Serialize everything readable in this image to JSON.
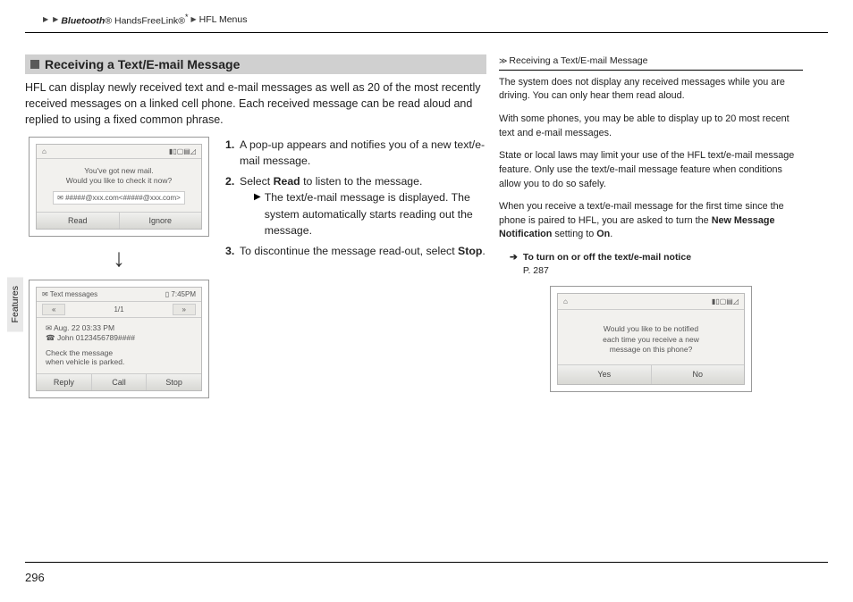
{
  "breadcrumb": {
    "b1": "Bluetooth",
    "reg": "®",
    "b2": " HandsFreeLink",
    "star": "*",
    "b3": "HFL Menus"
  },
  "section_title": "Receiving a Text/E-mail Message",
  "intro": "HFL can display newly received text and e-mail messages as well as 20 of the most recently received messages on a linked cell phone. Each received message can be read aloud and replied to using a fixed common phrase.",
  "steps": {
    "s1": "A pop-up appears and notifies you of a new text/e-mail message.",
    "s2a": "Select ",
    "s2b": "Read",
    "s2c": " to listen to the message.",
    "s2sub": "The text/e-mail message is displayed. The system automatically starts reading out the message.",
    "s3a": "To discontinue the message read-out, select ",
    "s3b": "Stop",
    "s3c": "."
  },
  "screen1": {
    "topL": "⌂",
    "topR": "▮▯▢▤◿",
    "line1": "You've got new mail.",
    "line2": "Would you like to check it now?",
    "email": "✉  #####@xxx.com<#####@xxx.com>",
    "btn1": "Read",
    "btn2": "Ignore"
  },
  "screen2": {
    "topL": "✉  Text messages",
    "topR": "▯ 7:45PM",
    "tabL": "«",
    "count": "1/1",
    "tabR": "»",
    "l1": "✉ Aug. 22 03:33 PM",
    "l2": "☎ John 0123456789####",
    "l3": "Check the message",
    "l4": "when vehicle is parked.",
    "btn1": "Reply",
    "btn2": "Call",
    "btn3": "Stop"
  },
  "side": {
    "title": "Receiving a Text/E-mail Message",
    "p1": "The system does not display any received messages while you are driving. You can only hear them read aloud.",
    "p2": "With some phones, you may be able to display up to 20 most recent text and e-mail messages.",
    "p3": "State or local laws may limit your use of the HFL text/e-mail message feature. Only use the text/e-mail message feature when conditions allow you to do so safely.",
    "p4a": "When you receive a text/e-mail message for the first time since the phone is paired to HFL, you are asked to turn the ",
    "p4b": "New Message Notification",
    "p4c": " setting to ",
    "p4d": "On",
    "p4e": ".",
    "xref": "To turn on or off the text/e-mail notice",
    "xref_page": "P. 287"
  },
  "screen3": {
    "topL": "⌂",
    "topR": "▮▯▢▤◿",
    "line1": "Would you like to be notified",
    "line2": "each time you receive a new",
    "line3": "message on this phone?",
    "btn1": "Yes",
    "btn2": "No"
  },
  "features_tab": "Features",
  "page_num": "296"
}
